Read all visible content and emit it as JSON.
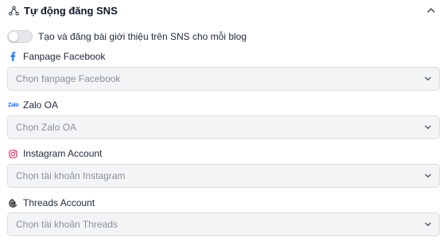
{
  "section": {
    "title": "Tự động đăng SNS",
    "header_icon": "share-nodes-icon",
    "collapse_icon": "chevron-up-icon"
  },
  "auto_post": {
    "label": "Tạo và đăng bài giới thiệu trên SNS cho mỗi blog",
    "enabled": false
  },
  "fields": {
    "facebook": {
      "label": "Fanpage Facebook",
      "icon": "facebook-icon",
      "placeholder": "Chọn fanpage Facebook"
    },
    "zalo": {
      "label": "Zalo OA",
      "icon_text": "Zalo",
      "placeholder": "Chọn Zalo OA"
    },
    "instagram": {
      "label": "Instagram Account",
      "icon": "instagram-icon",
      "placeholder": "Chọn tài khoản Instagram"
    },
    "threads": {
      "label": "Threads Account",
      "icon": "threads-icon",
      "placeholder": "Chọn tài khoản Threads"
    }
  },
  "colors": {
    "facebook": "#1877f2",
    "zalo": "#1d6ff2",
    "instagram": "#e1306c",
    "threads": "#111111"
  }
}
